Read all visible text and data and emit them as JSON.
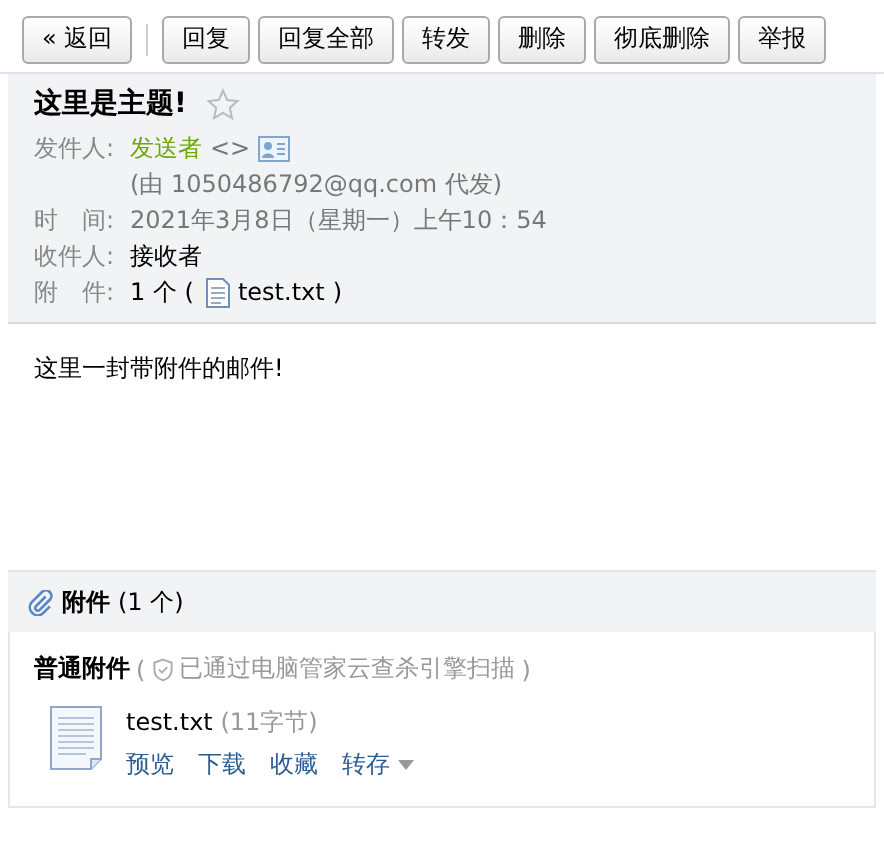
{
  "toolbar": {
    "buttons": [
      {
        "label": "« 返回",
        "kind": "back"
      },
      {
        "label": "回复",
        "kind": "action"
      },
      {
        "label": "回复全部",
        "kind": "action"
      },
      {
        "label": "转发",
        "kind": "action"
      },
      {
        "label": "删除",
        "kind": "action"
      },
      {
        "label": "彻底删除",
        "kind": "action"
      },
      {
        "label": "举报",
        "kind": "action"
      }
    ]
  },
  "header": {
    "subject": "这里是主题!",
    "starred": false,
    "sender": {
      "label": "发件人:",
      "name": "发送者",
      "address": "<>",
      "via": "(由 1050486792@qq.com 代发)"
    },
    "time": {
      "label": "时　间:",
      "value": "2021年3月8日（星期一）上午10：54"
    },
    "recipient": {
      "label": "收件人:",
      "value": "接收者"
    },
    "attachments": {
      "label": "附　件:",
      "count": "1 个 (",
      "file": "test.txt",
      "close": ")"
    }
  },
  "body": "这里一封带附件的邮件!",
  "attachment_panel": {
    "title": "附件",
    "count": "(1 个)",
    "group": "普通附件",
    "scan_open": "(",
    "scan_note": "已通过电脑管家云查杀引擎扫描",
    "scan_close": ")",
    "files": [
      {
        "name": "test.txt",
        "size": "(11字节)",
        "actions": [
          {
            "label": "预览",
            "kind": "link"
          },
          {
            "label": "下载",
            "kind": "link"
          },
          {
            "label": "收藏",
            "kind": "link"
          },
          {
            "label": "转存",
            "kind": "menu"
          }
        ]
      }
    ]
  }
}
